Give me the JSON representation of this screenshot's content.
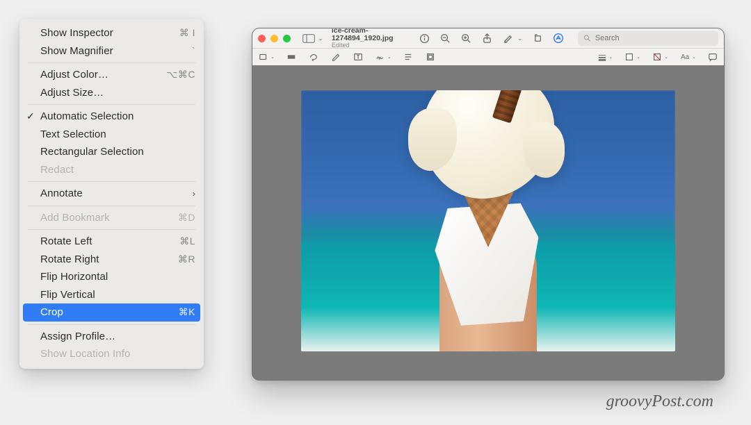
{
  "menu": {
    "items": [
      {
        "label": "Show Inspector",
        "shortcut": "⌘ I",
        "kind": "item"
      },
      {
        "label": "Show Magnifier",
        "shortcut": "`",
        "kind": "item"
      },
      {
        "kind": "sep"
      },
      {
        "label": "Adjust Color…",
        "shortcut": "⌥⌘C",
        "kind": "item"
      },
      {
        "label": "Adjust Size…",
        "shortcut": "",
        "kind": "item"
      },
      {
        "kind": "sep"
      },
      {
        "label": "Automatic Selection",
        "shortcut": "",
        "kind": "item",
        "checked": true
      },
      {
        "label": "Text Selection",
        "shortcut": "",
        "kind": "item"
      },
      {
        "label": "Rectangular Selection",
        "shortcut": "",
        "kind": "item"
      },
      {
        "label": "Redact",
        "shortcut": "",
        "kind": "item",
        "disabled": true
      },
      {
        "kind": "sep"
      },
      {
        "label": "Annotate",
        "shortcut": "",
        "kind": "submenu"
      },
      {
        "kind": "sep"
      },
      {
        "label": "Add Bookmark",
        "shortcut": "⌘D",
        "kind": "item",
        "disabled": true
      },
      {
        "kind": "sep"
      },
      {
        "label": "Rotate Left",
        "shortcut": "⌘L",
        "kind": "item"
      },
      {
        "label": "Rotate Right",
        "shortcut": "⌘R",
        "kind": "item"
      },
      {
        "label": "Flip Horizontal",
        "shortcut": "",
        "kind": "item"
      },
      {
        "label": "Flip Vertical",
        "shortcut": "",
        "kind": "item"
      },
      {
        "label": "Crop",
        "shortcut": "⌘K",
        "kind": "item",
        "highlight": true
      },
      {
        "kind": "sep"
      },
      {
        "label": "Assign Profile…",
        "shortcut": "",
        "kind": "item"
      },
      {
        "label": "Show Location Info",
        "shortcut": "",
        "kind": "item",
        "disabled": true
      }
    ]
  },
  "window": {
    "filename": "ice-cream-1274894_1920.jpg",
    "status": "Edited",
    "search_placeholder": "Search"
  },
  "title_icons": [
    "info",
    "zoom-out",
    "zoom-in",
    "share",
    "highlighter",
    "rotate",
    "markup"
  ],
  "toolbar_icons": [
    "shapes",
    "redact",
    "lasso",
    "sketch",
    "text-box",
    "sign",
    "align",
    "crop-tool",
    "stroke",
    "fill",
    "line-style",
    "font",
    "annotate-note"
  ],
  "watermark": "groovyPost.com"
}
